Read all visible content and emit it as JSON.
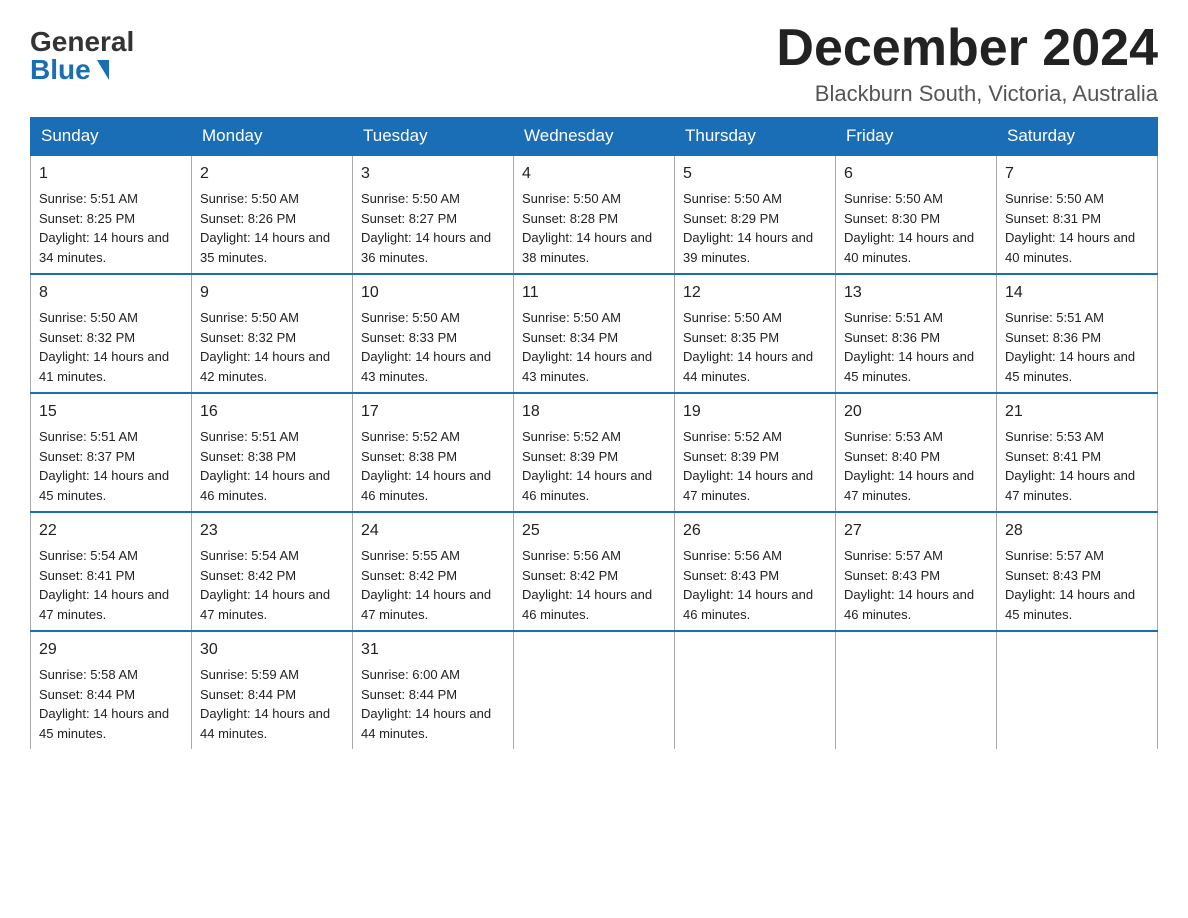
{
  "header": {
    "logo_general": "General",
    "logo_blue": "Blue",
    "month_title": "December 2024",
    "location": "Blackburn South, Victoria, Australia"
  },
  "days_of_week": [
    "Sunday",
    "Monday",
    "Tuesday",
    "Wednesday",
    "Thursday",
    "Friday",
    "Saturday"
  ],
  "weeks": [
    [
      {
        "day": "1",
        "sunrise": "5:51 AM",
        "sunset": "8:25 PM",
        "daylight": "14 hours and 34 minutes."
      },
      {
        "day": "2",
        "sunrise": "5:50 AM",
        "sunset": "8:26 PM",
        "daylight": "14 hours and 35 minutes."
      },
      {
        "day": "3",
        "sunrise": "5:50 AM",
        "sunset": "8:27 PM",
        "daylight": "14 hours and 36 minutes."
      },
      {
        "day": "4",
        "sunrise": "5:50 AM",
        "sunset": "8:28 PM",
        "daylight": "14 hours and 38 minutes."
      },
      {
        "day": "5",
        "sunrise": "5:50 AM",
        "sunset": "8:29 PM",
        "daylight": "14 hours and 39 minutes."
      },
      {
        "day": "6",
        "sunrise": "5:50 AM",
        "sunset": "8:30 PM",
        "daylight": "14 hours and 40 minutes."
      },
      {
        "day": "7",
        "sunrise": "5:50 AM",
        "sunset": "8:31 PM",
        "daylight": "14 hours and 40 minutes."
      }
    ],
    [
      {
        "day": "8",
        "sunrise": "5:50 AM",
        "sunset": "8:32 PM",
        "daylight": "14 hours and 41 minutes."
      },
      {
        "day": "9",
        "sunrise": "5:50 AM",
        "sunset": "8:32 PM",
        "daylight": "14 hours and 42 minutes."
      },
      {
        "day": "10",
        "sunrise": "5:50 AM",
        "sunset": "8:33 PM",
        "daylight": "14 hours and 43 minutes."
      },
      {
        "day": "11",
        "sunrise": "5:50 AM",
        "sunset": "8:34 PM",
        "daylight": "14 hours and 43 minutes."
      },
      {
        "day": "12",
        "sunrise": "5:50 AM",
        "sunset": "8:35 PM",
        "daylight": "14 hours and 44 minutes."
      },
      {
        "day": "13",
        "sunrise": "5:51 AM",
        "sunset": "8:36 PM",
        "daylight": "14 hours and 45 minutes."
      },
      {
        "day": "14",
        "sunrise": "5:51 AM",
        "sunset": "8:36 PM",
        "daylight": "14 hours and 45 minutes."
      }
    ],
    [
      {
        "day": "15",
        "sunrise": "5:51 AM",
        "sunset": "8:37 PM",
        "daylight": "14 hours and 45 minutes."
      },
      {
        "day": "16",
        "sunrise": "5:51 AM",
        "sunset": "8:38 PM",
        "daylight": "14 hours and 46 minutes."
      },
      {
        "day": "17",
        "sunrise": "5:52 AM",
        "sunset": "8:38 PM",
        "daylight": "14 hours and 46 minutes."
      },
      {
        "day": "18",
        "sunrise": "5:52 AM",
        "sunset": "8:39 PM",
        "daylight": "14 hours and 46 minutes."
      },
      {
        "day": "19",
        "sunrise": "5:52 AM",
        "sunset": "8:39 PM",
        "daylight": "14 hours and 47 minutes."
      },
      {
        "day": "20",
        "sunrise": "5:53 AM",
        "sunset": "8:40 PM",
        "daylight": "14 hours and 47 minutes."
      },
      {
        "day": "21",
        "sunrise": "5:53 AM",
        "sunset": "8:41 PM",
        "daylight": "14 hours and 47 minutes."
      }
    ],
    [
      {
        "day": "22",
        "sunrise": "5:54 AM",
        "sunset": "8:41 PM",
        "daylight": "14 hours and 47 minutes."
      },
      {
        "day": "23",
        "sunrise": "5:54 AM",
        "sunset": "8:42 PM",
        "daylight": "14 hours and 47 minutes."
      },
      {
        "day": "24",
        "sunrise": "5:55 AM",
        "sunset": "8:42 PM",
        "daylight": "14 hours and 47 minutes."
      },
      {
        "day": "25",
        "sunrise": "5:56 AM",
        "sunset": "8:42 PM",
        "daylight": "14 hours and 46 minutes."
      },
      {
        "day": "26",
        "sunrise": "5:56 AM",
        "sunset": "8:43 PM",
        "daylight": "14 hours and 46 minutes."
      },
      {
        "day": "27",
        "sunrise": "5:57 AM",
        "sunset": "8:43 PM",
        "daylight": "14 hours and 46 minutes."
      },
      {
        "day": "28",
        "sunrise": "5:57 AM",
        "sunset": "8:43 PM",
        "daylight": "14 hours and 45 minutes."
      }
    ],
    [
      {
        "day": "29",
        "sunrise": "5:58 AM",
        "sunset": "8:44 PM",
        "daylight": "14 hours and 45 minutes."
      },
      {
        "day": "30",
        "sunrise": "5:59 AM",
        "sunset": "8:44 PM",
        "daylight": "14 hours and 44 minutes."
      },
      {
        "day": "31",
        "sunrise": "6:00 AM",
        "sunset": "8:44 PM",
        "daylight": "14 hours and 44 minutes."
      },
      null,
      null,
      null,
      null
    ]
  ],
  "labels": {
    "sunrise": "Sunrise:",
    "sunset": "Sunset:",
    "daylight": "Daylight:"
  }
}
